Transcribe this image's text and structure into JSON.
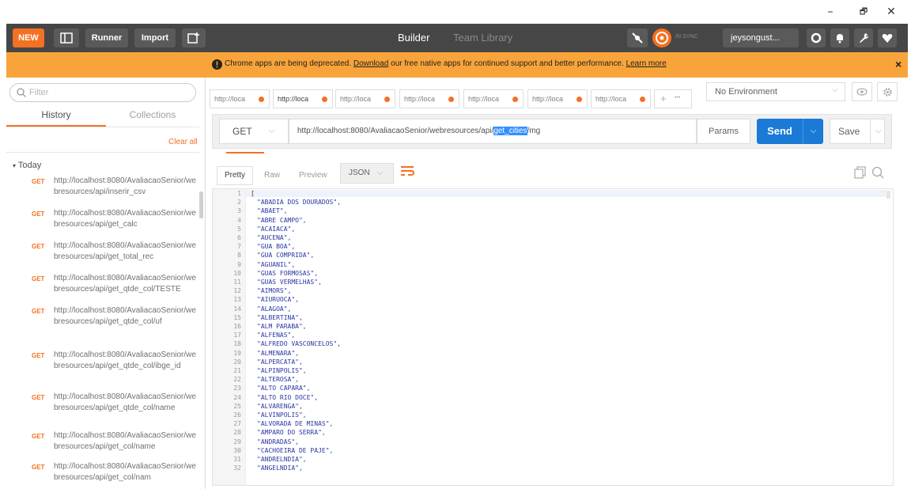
{
  "window": {
    "minimize": "–",
    "maximize": "🗗",
    "close": "✕"
  },
  "toolbar": {
    "new_label": "NEW",
    "runner_label": "Runner",
    "import_label": "Import",
    "builder_label": "Builder",
    "team_library_label": "Team Library",
    "sync_label": "IN SYNC",
    "user_label": "jeysongust...",
    "accent_color": "#f47023",
    "sync_color": "#f47023"
  },
  "banner": {
    "text_before": "Chrome apps are being deprecated.",
    "link1": "Download",
    "text_middle": "our free native apps for continued support and better performance.",
    "link2": "Learn more",
    "close": "×"
  },
  "sidebar": {
    "filter_placeholder": "Filter",
    "tab_history": "History",
    "tab_collections": "Collections",
    "clear_all": "Clear all",
    "group_label": "Today",
    "items": [
      {
        "method": "GET",
        "url": "http://localhost:8080/AvaliacaoSenior/webresources/api/inserir_csv"
      },
      {
        "method": "GET",
        "url": "http://localhost:8080/AvaliacaoSenior/webresources/api/get_calc"
      },
      {
        "method": "GET",
        "url": "http://localhost:8080/AvaliacaoSenior/webresources/api/get_total_rec"
      },
      {
        "method": "GET",
        "url": "http://localhost:8080/AvaliacaoSenior/webresources/api/get_qtde_col/TESTE"
      },
      {
        "method": "GET",
        "url": "http://localhost:8080/AvaliacaoSenior/webresources/api/get_qtde_col/uf"
      },
      {
        "method": "GET",
        "url": "http://localhost:8080/AvaliacaoSenior/webresources/api/get_qtde_col/ibge_id"
      },
      {
        "method": "GET",
        "url": "http://localhost:8080/AvaliacaoSenior/webresources/api/get_qtde_col/name"
      },
      {
        "method": "GET",
        "url": "http://localhost:8080/AvaliacaoSenior/webresources/api/get_col/name"
      },
      {
        "method": "GET",
        "url": "http://localhost:8080/AvaliacaoSenior/webresources/api/get_col/nam"
      }
    ]
  },
  "tabs": {
    "items": [
      "http://loca",
      "http://loca",
      "http://loca",
      "http://loca",
      "http://loca",
      "http://loca",
      "http://loca"
    ],
    "add": "+",
    "more": "•••"
  },
  "environment": {
    "selected": "No Environment"
  },
  "request": {
    "method": "GET",
    "url_before": "http://localhost:8080/AvaliacaoSenior/webresources/api/",
    "url_selected": "get_cities",
    "url_after": "/mg",
    "params_label": "Params",
    "send_label": "Send",
    "save_label": "Save"
  },
  "response": {
    "tab_pretty": "Pretty",
    "tab_raw": "Raw",
    "tab_preview": "Preview",
    "format": "JSON",
    "lines": [
      {
        "n": "1",
        "text": "["
      },
      {
        "n": "2",
        "text": "\"ABADIA DOS DOURADOS\","
      },
      {
        "n": "3",
        "text": "\"ABAET\","
      },
      {
        "n": "4",
        "text": "\"ABRE CAMPO\","
      },
      {
        "n": "5",
        "text": "\"ACAIACA\","
      },
      {
        "n": "6",
        "text": "\"AUCENA\","
      },
      {
        "n": "7",
        "text": "\"GUA BOA\","
      },
      {
        "n": "8",
        "text": "\"GUA COMPRIDA\","
      },
      {
        "n": "9",
        "text": "\"AGUANIL\","
      },
      {
        "n": "10",
        "text": "\"GUAS FORMOSAS\","
      },
      {
        "n": "11",
        "text": "\"GUAS VERMELHAS\","
      },
      {
        "n": "12",
        "text": "\"AIMORS\","
      },
      {
        "n": "13",
        "text": "\"AIURUOCA\","
      },
      {
        "n": "14",
        "text": "\"ALAGOA\","
      },
      {
        "n": "15",
        "text": "\"ALBERTINA\","
      },
      {
        "n": "16",
        "text": "\"ALM PARABA\","
      },
      {
        "n": "17",
        "text": "\"ALFENAS\","
      },
      {
        "n": "18",
        "text": "\"ALFREDO VASCONCELOS\","
      },
      {
        "n": "19",
        "text": "\"ALMENARA\","
      },
      {
        "n": "20",
        "text": "\"ALPERCATA\","
      },
      {
        "n": "21",
        "text": "\"ALPINPOLIS\","
      },
      {
        "n": "22",
        "text": "\"ALTEROSA\","
      },
      {
        "n": "23",
        "text": "\"ALTO CAPARA\","
      },
      {
        "n": "24",
        "text": "\"ALTO RIO DOCE\","
      },
      {
        "n": "25",
        "text": "\"ALVARENGA\","
      },
      {
        "n": "26",
        "text": "\"ALVINPOLIS\","
      },
      {
        "n": "27",
        "text": "\"ALVORADA DE MINAS\","
      },
      {
        "n": "28",
        "text": "\"AMPARO DO SERRA\","
      },
      {
        "n": "29",
        "text": "\"ANDRADAS\","
      },
      {
        "n": "30",
        "text": "\"CACHOEIRA DE PAJE\","
      },
      {
        "n": "31",
        "text": "\"ANDRELNDIA\","
      },
      {
        "n": "32",
        "text": "\"ANGELNDIA\","
      }
    ]
  }
}
